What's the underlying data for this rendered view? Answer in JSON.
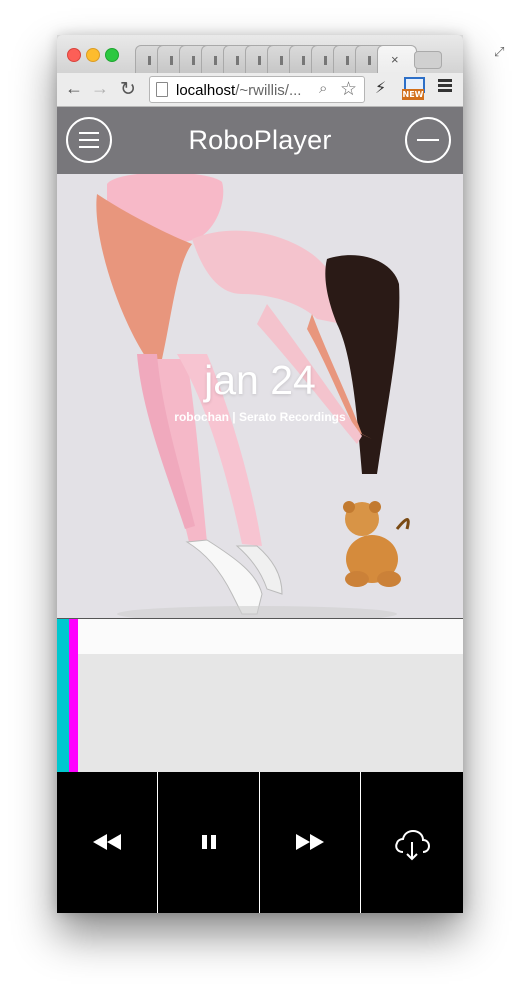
{
  "browser": {
    "url_host": "localhost",
    "url_path": "/~rwillis/...",
    "ext_badge": "NEW",
    "tab_close": "×"
  },
  "app": {
    "title": "RoboPlayer"
  },
  "now_playing": {
    "track_title": "jan 24",
    "artist_line": "robochan | Serato Recordings",
    "progress_fraction": 0.05
  },
  "controls": {
    "items": [
      "rewind-icon",
      "pause-icon",
      "fast-forward-icon",
      "cloud-download-icon"
    ]
  },
  "colors": {
    "header_bg": "#78777b",
    "progress_cyan": "#00c8cf",
    "progress_magenta": "#ff00ff",
    "controls_bg": "#000000"
  }
}
